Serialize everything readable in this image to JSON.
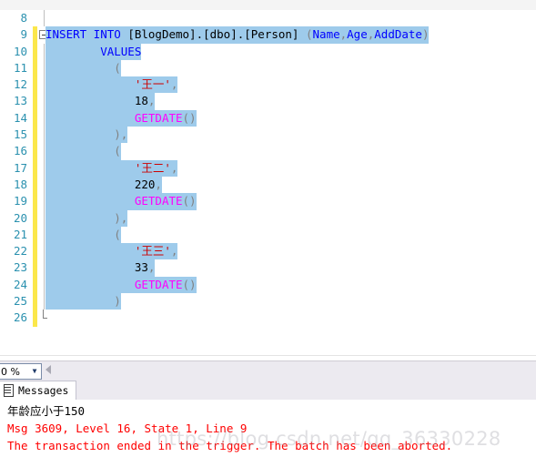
{
  "toolbar": {
    "strip_label": ""
  },
  "editor": {
    "first_line_number": 8,
    "last_line_number": 26,
    "collapse_icon": "collapse-minus-icon",
    "change_bar_color": "#fbe74b",
    "selection_color": "#9ecbeb",
    "lines": [
      {
        "num": "8",
        "indent": 0,
        "selected": false,
        "changed": false,
        "tokens": []
      },
      {
        "num": "9",
        "indent": 0,
        "selected": true,
        "changed": true,
        "collapse": true,
        "tokens": [
          {
            "t": "INSERT INTO ",
            "c": "kw"
          },
          {
            "t": "[BlogDemo].[dbo].[Person] ",
            "c": "tbl"
          },
          {
            "t": "(",
            "c": "punc"
          },
          {
            "t": "Name",
            "c": "ident"
          },
          {
            "t": ",",
            "c": "punc"
          },
          {
            "t": "Age",
            "c": "ident"
          },
          {
            "t": ",",
            "c": "punc"
          },
          {
            "t": "AddDate",
            "c": "ident"
          },
          {
            "t": ")",
            "c": "punc"
          }
        ]
      },
      {
        "num": "10",
        "indent": 0,
        "selected": true,
        "changed": true,
        "tokens": [
          {
            "t": "        VALUES",
            "c": "kw"
          }
        ]
      },
      {
        "num": "11",
        "indent": 0,
        "selected": true,
        "changed": true,
        "tokens": [
          {
            "t": "          (",
            "c": "punc"
          }
        ]
      },
      {
        "num": "12",
        "indent": 0,
        "selected": true,
        "changed": true,
        "tokens": [
          {
            "t": "             ",
            "c": "plain"
          },
          {
            "t": "'王一'",
            "c": "str"
          },
          {
            "t": ",",
            "c": "punc"
          }
        ]
      },
      {
        "num": "13",
        "indent": 0,
        "selected": true,
        "changed": true,
        "tokens": [
          {
            "t": "             ",
            "c": "plain"
          },
          {
            "t": "18",
            "c": "num"
          },
          {
            "t": ",",
            "c": "punc"
          }
        ]
      },
      {
        "num": "14",
        "indent": 0,
        "selected": true,
        "changed": true,
        "tokens": [
          {
            "t": "             ",
            "c": "plain"
          },
          {
            "t": "GETDATE",
            "c": "fn"
          },
          {
            "t": "()",
            "c": "punc"
          }
        ]
      },
      {
        "num": "15",
        "indent": 0,
        "selected": true,
        "changed": true,
        "tokens": [
          {
            "t": "          ),",
            "c": "punc"
          }
        ]
      },
      {
        "num": "16",
        "indent": 0,
        "selected": true,
        "changed": true,
        "tokens": [
          {
            "t": "          (",
            "c": "punc"
          }
        ]
      },
      {
        "num": "17",
        "indent": 0,
        "selected": true,
        "changed": true,
        "tokens": [
          {
            "t": "             ",
            "c": "plain"
          },
          {
            "t": "'王二'",
            "c": "str"
          },
          {
            "t": ",",
            "c": "punc"
          }
        ]
      },
      {
        "num": "18",
        "indent": 0,
        "selected": true,
        "changed": true,
        "tokens": [
          {
            "t": "             ",
            "c": "plain"
          },
          {
            "t": "220",
            "c": "num"
          },
          {
            "t": ",",
            "c": "punc"
          }
        ]
      },
      {
        "num": "19",
        "indent": 0,
        "selected": true,
        "changed": true,
        "tokens": [
          {
            "t": "             ",
            "c": "plain"
          },
          {
            "t": "GETDATE",
            "c": "fn"
          },
          {
            "t": "()",
            "c": "punc"
          }
        ]
      },
      {
        "num": "20",
        "indent": 0,
        "selected": true,
        "changed": true,
        "tokens": [
          {
            "t": "          ),",
            "c": "punc"
          }
        ]
      },
      {
        "num": "21",
        "indent": 0,
        "selected": true,
        "changed": true,
        "tokens": [
          {
            "t": "          (",
            "c": "punc"
          }
        ]
      },
      {
        "num": "22",
        "indent": 0,
        "selected": true,
        "changed": true,
        "tokens": [
          {
            "t": "             ",
            "c": "plain"
          },
          {
            "t": "'王三'",
            "c": "str"
          },
          {
            "t": ",",
            "c": "punc"
          }
        ]
      },
      {
        "num": "23",
        "indent": 0,
        "selected": true,
        "changed": true,
        "tokens": [
          {
            "t": "             ",
            "c": "plain"
          },
          {
            "t": "33",
            "c": "num"
          },
          {
            "t": ",",
            "c": "punc"
          }
        ]
      },
      {
        "num": "24",
        "indent": 0,
        "selected": true,
        "changed": true,
        "tokens": [
          {
            "t": "             ",
            "c": "plain"
          },
          {
            "t": "GETDATE",
            "c": "fn"
          },
          {
            "t": "()",
            "c": "punc"
          }
        ]
      },
      {
        "num": "25",
        "indent": 0,
        "selected": true,
        "changed": true,
        "tokens": [
          {
            "t": "          )",
            "c": "punc"
          }
        ]
      },
      {
        "num": "26",
        "indent": 0,
        "selected": false,
        "changed": true,
        "region_end": true,
        "tokens": []
      }
    ]
  },
  "results_bar": {
    "zoom_value": "0 %",
    "zoom_arrow": "▼",
    "scroll_left_icon": "scroll-left-arrow-icon"
  },
  "tabs": {
    "messages": {
      "label": "Messages",
      "icon": "grid-results-icon",
      "active": true
    }
  },
  "messages": {
    "lines": [
      {
        "text": "年龄应小于150",
        "color": "black"
      },
      {
        "text": "Msg 3609, Level 16, State 1, Line 9",
        "color": "red"
      },
      {
        "text": "The transaction ended in the trigger. The batch has been aborted.",
        "color": "red"
      }
    ]
  },
  "watermark": {
    "text": "https://blog.csdn.net/qq_36330228"
  }
}
